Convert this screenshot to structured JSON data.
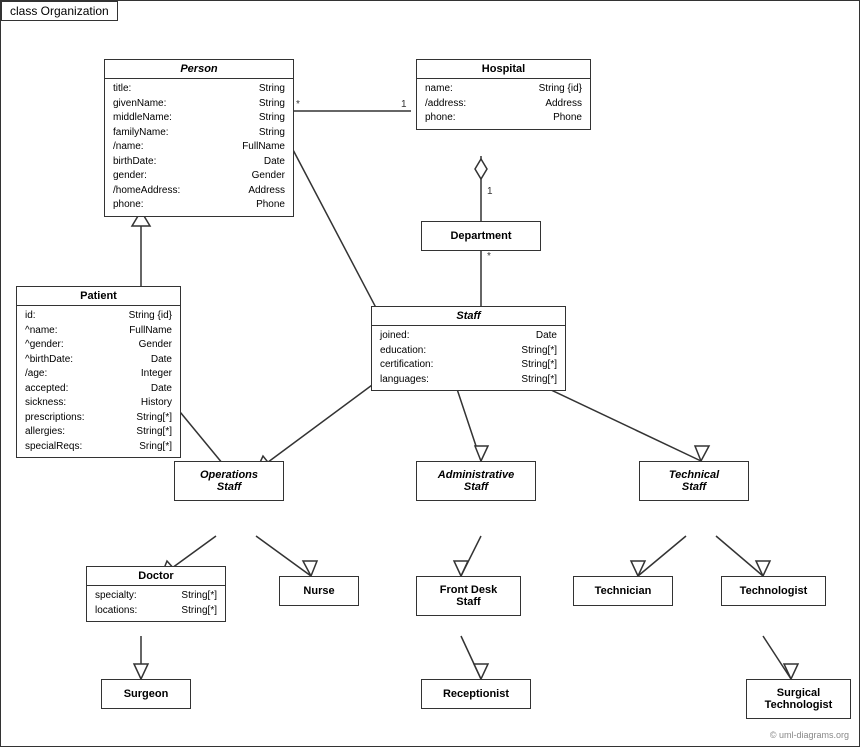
{
  "diagram": {
    "title": "class Organization",
    "watermark": "© uml-diagrams.org",
    "classes": {
      "person": {
        "name": "Person",
        "italic": true,
        "attrs": [
          {
            "name": "title:",
            "type": "String"
          },
          {
            "name": "givenName:",
            "type": "String"
          },
          {
            "name": "middleName:",
            "type": "String"
          },
          {
            "name": "familyName:",
            "type": "String"
          },
          {
            "name": "/name:",
            "type": "FullName"
          },
          {
            "name": "birthDate:",
            "type": "Date"
          },
          {
            "name": "gender:",
            "type": "Gender"
          },
          {
            "name": "/homeAddress:",
            "type": "Address"
          },
          {
            "name": "phone:",
            "type": "Phone"
          }
        ]
      },
      "hospital": {
        "name": "Hospital",
        "italic": false,
        "attrs": [
          {
            "name": "name:",
            "type": "String {id}"
          },
          {
            "name": "/address:",
            "type": "Address"
          },
          {
            "name": "phone:",
            "type": "Phone"
          }
        ]
      },
      "department": {
        "name": "Department",
        "italic": false,
        "attrs": []
      },
      "patient": {
        "name": "Patient",
        "italic": false,
        "attrs": [
          {
            "name": "id:",
            "type": "String {id}"
          },
          {
            "name": "^name:",
            "type": "FullName"
          },
          {
            "name": "^gender:",
            "type": "Gender"
          },
          {
            "name": "^birthDate:",
            "type": "Date"
          },
          {
            "name": "/age:",
            "type": "Integer"
          },
          {
            "name": "accepted:",
            "type": "Date"
          },
          {
            "name": "sickness:",
            "type": "History"
          },
          {
            "name": "prescriptions:",
            "type": "String[*]"
          },
          {
            "name": "allergies:",
            "type": "String[*]"
          },
          {
            "name": "specialReqs:",
            "type": "Sring[*]"
          }
        ]
      },
      "staff": {
        "name": "Staff",
        "italic": true,
        "attrs": [
          {
            "name": "joined:",
            "type": "Date"
          },
          {
            "name": "education:",
            "type": "String[*]"
          },
          {
            "name": "certification:",
            "type": "String[*]"
          },
          {
            "name": "languages:",
            "type": "String[*]"
          }
        ]
      },
      "operations_staff": {
        "name": "Operations\nStaff",
        "italic": true,
        "attrs": []
      },
      "administrative_staff": {
        "name": "Administrative\nStaff",
        "italic": true,
        "attrs": []
      },
      "technical_staff": {
        "name": "Technical\nStaff",
        "italic": true,
        "attrs": []
      },
      "doctor": {
        "name": "Doctor",
        "italic": false,
        "attrs": [
          {
            "name": "specialty:",
            "type": "String[*]"
          },
          {
            "name": "locations:",
            "type": "String[*]"
          }
        ]
      },
      "nurse": {
        "name": "Nurse",
        "italic": false,
        "attrs": []
      },
      "front_desk_staff": {
        "name": "Front Desk\nStaff",
        "italic": false,
        "attrs": []
      },
      "technician": {
        "name": "Technician",
        "italic": false,
        "attrs": []
      },
      "technologist": {
        "name": "Technologist",
        "italic": false,
        "attrs": []
      },
      "surgeon": {
        "name": "Surgeon",
        "italic": false,
        "attrs": []
      },
      "receptionist": {
        "name": "Receptionist",
        "italic": false,
        "attrs": []
      },
      "surgical_technologist": {
        "name": "Surgical\nTechnologist",
        "italic": false,
        "attrs": []
      }
    }
  }
}
